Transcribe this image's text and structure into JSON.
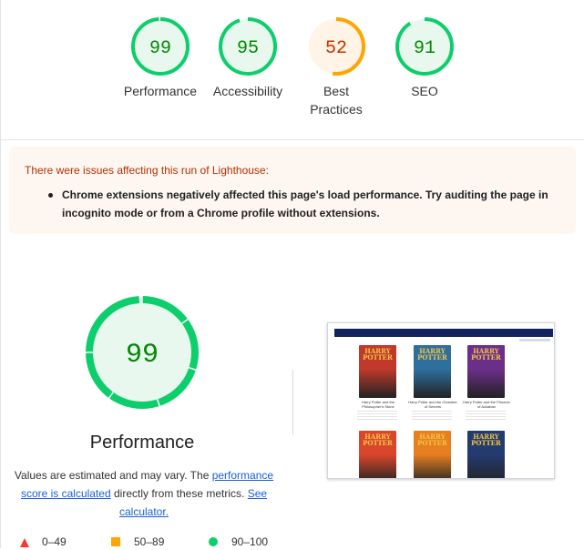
{
  "category_gauges": [
    {
      "score": "99",
      "label": "Performance",
      "color": "#0cce6b",
      "bg": "#e8f8ee",
      "text_color": "#008800",
      "fraction": 0.99
    },
    {
      "score": "95",
      "label": "Accessibility",
      "color": "#0cce6b",
      "bg": "#e8f8ee",
      "text_color": "#008800",
      "fraction": 0.95
    },
    {
      "score": "52",
      "label": "Best Practices",
      "color": "#ffa400",
      "bg": "#fff4e5",
      "text_color": "#c33300",
      "fraction": 0.52
    },
    {
      "score": "91",
      "label": "SEO",
      "color": "#0cce6b",
      "bg": "#e8f8ee",
      "text_color": "#008800",
      "fraction": 0.91
    }
  ],
  "warning": {
    "title": "There were issues affecting this run of Lighthouse:",
    "items": [
      "Chrome extensions negatively affected this page's load performance. Try auditing the page in incognito mode or from a Chrome profile without extensions."
    ]
  },
  "performance": {
    "score": "99",
    "fraction": 0.99,
    "title": "Performance",
    "desc_prefix": "Values are estimated and may vary. The ",
    "link_score": "performance score is calculated",
    "desc_middle": " directly from these metrics. ",
    "link_calculator": "See calculator."
  },
  "legend": [
    {
      "range": "0–49",
      "shape": "triangle",
      "color": "#ff3333"
    },
    {
      "range": "50–89",
      "shape": "square",
      "color": "#ffa400"
    },
    {
      "range": "90–100",
      "shape": "circle",
      "color": "#0cce6b"
    }
  ],
  "screenshot": {
    "books": [
      {
        "title_line1": "HARRY",
        "title_line2": "POTTER",
        "caption_line1": "Harry Potter and the",
        "caption_line2": "Philosopher's Stone",
        "color": "#c0392b"
      },
      {
        "title_line1": "HARRY",
        "title_line2": "POTTER",
        "caption_line1": "Harry Potter and the",
        "caption_line2": "Chamber of Secrets",
        "color": "#2e6f9e"
      },
      {
        "title_line1": "HARRY",
        "title_line2": "POTTER",
        "caption_line1": "Harry Potter and the",
        "caption_line2": "Prisoner of Azkaban",
        "color": "#6b2f8a"
      },
      {
        "title_line1": "HARRY",
        "title_line2": "POTTER",
        "caption_line1": "",
        "caption_line2": "",
        "color": "#d9462b"
      },
      {
        "title_line1": "HARRY",
        "title_line2": "POTTER",
        "caption_line1": "",
        "caption_line2": "",
        "color": "#e67e22"
      },
      {
        "title_line1": "HARRY",
        "title_line2": "POTTER",
        "caption_line1": "",
        "caption_line2": "",
        "color": "#243b70"
      }
    ]
  }
}
